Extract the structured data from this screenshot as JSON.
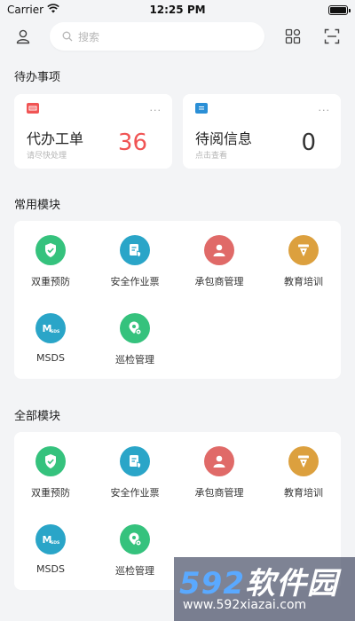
{
  "status": {
    "carrier": "Carrier",
    "time": "12:25 PM",
    "battery_level": 1.0
  },
  "search": {
    "placeholder": "搜索"
  },
  "todo": {
    "section_title": "待办事项",
    "cards": [
      {
        "title": "代办工单",
        "subtitle": "请尽快处理",
        "count": "36",
        "count_color": "#f05454",
        "more": "···",
        "icon": "ticket-icon"
      },
      {
        "title": "待阅信息",
        "subtitle": "点击查看",
        "count": "0",
        "count_color": "#333333",
        "more": "···",
        "icon": "message-icon"
      }
    ]
  },
  "common_modules": {
    "section_title": "常用模块",
    "items": [
      {
        "label": "双重预防",
        "icon": "shield-icon",
        "color": "#35c27d"
      },
      {
        "label": "安全作业票",
        "icon": "safety-ticket-icon",
        "color": "#2aa5c8"
      },
      {
        "label": "承包商管理",
        "icon": "person-icon",
        "color": "#e06a68"
      },
      {
        "label": "教育培训",
        "icon": "pen-icon",
        "color": "#dca03e"
      },
      {
        "label": "MSDS",
        "icon": "msds-icon",
        "color": "#2aa5c8"
      },
      {
        "label": "巡检管理",
        "icon": "location-icon",
        "color": "#35c27d"
      }
    ]
  },
  "all_modules": {
    "section_title": "全部模块",
    "items": [
      {
        "label": "双重预防",
        "icon": "shield-icon",
        "color": "#35c27d"
      },
      {
        "label": "安全作业票",
        "icon": "safety-ticket-icon",
        "color": "#2aa5c8"
      },
      {
        "label": "承包商管理",
        "icon": "person-icon",
        "color": "#e06a68"
      },
      {
        "label": "教育培训",
        "icon": "pen-icon",
        "color": "#dca03e"
      },
      {
        "label": "MSDS",
        "icon": "msds-icon",
        "color": "#2aa5c8"
      },
      {
        "label": "巡检管理",
        "icon": "location-icon",
        "color": "#35c27d"
      }
    ]
  },
  "watermark": {
    "brand_digits": "592",
    "brand_text": "软件园",
    "url": "www.592xiazai.com"
  }
}
